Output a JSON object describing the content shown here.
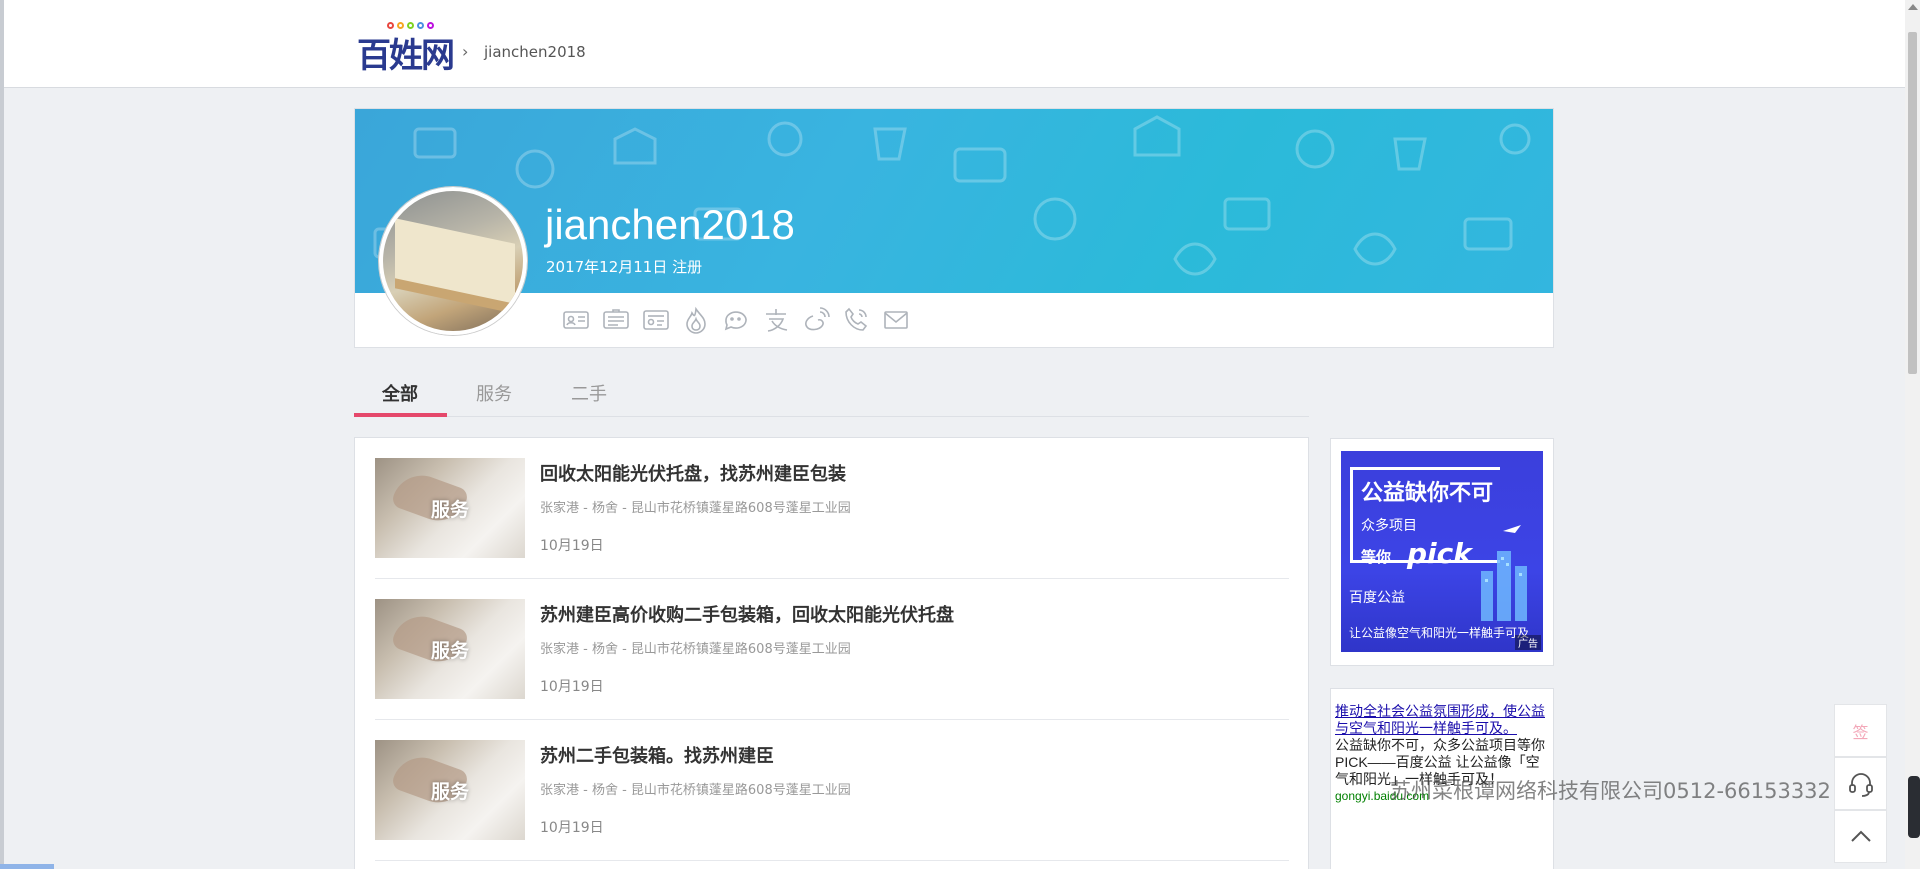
{
  "header": {
    "logo_text": "百姓网",
    "breadcrumb_user": "jianchen2018",
    "breadcrumb_separator": "›"
  },
  "profile": {
    "username": "jianchen2018",
    "registered": "2017年12月11日 注册",
    "icons": [
      "id-card-icon",
      "business-card-icon",
      "license-icon",
      "fire-icon",
      "chat-bubble-icon",
      "alipay-icon",
      "weibo-icon",
      "phone-icon",
      "mail-icon"
    ]
  },
  "tabs": [
    {
      "label": "全部",
      "active": true
    },
    {
      "label": "服务",
      "active": false
    },
    {
      "label": "二手",
      "active": false
    }
  ],
  "listings": [
    {
      "badge": "服务",
      "title": "回收太阳能光伏托盘，找苏州建臣包装",
      "location": "张家港 - 杨舍 - 昆山市花桥镇蓬星路608号蓬星工业园",
      "date": "10月19日"
    },
    {
      "badge": "服务",
      "title": "苏州建臣高价收购二手包装箱，回收太阳能光伏托盘",
      "location": "张家港 - 杨舍 - 昆山市花桥镇蓬星路608号蓬星工业园",
      "date": "10月19日"
    },
    {
      "badge": "服务",
      "title": "苏州二手包装箱。找苏州建臣",
      "location": "张家港 - 杨舍 - 昆山市花桥镇蓬星路608号蓬星工业园",
      "date": "10月19日"
    }
  ],
  "ad_image": {
    "headline": "公益缺你不可",
    "line2": "众多项目",
    "line3": "等你",
    "pick": "pick",
    "brand": "百度公益",
    "slogan": "让公益像空气和阳光一样触手可及",
    "tag": "广告"
  },
  "ad_text": {
    "link": "推动全社会公益氛围形成，使公益与空气和阳光一样触手可及。",
    "desc": "公益缺你不可，众多公益项目等你PICK——百度公益 让公益像「空气和阳光」一样触手可及！",
    "url": "gongyi.baidu.com"
  },
  "watermark": "苏州菜根谭网络科技有限公司0512-66153332",
  "tools": {
    "sign": "签"
  }
}
